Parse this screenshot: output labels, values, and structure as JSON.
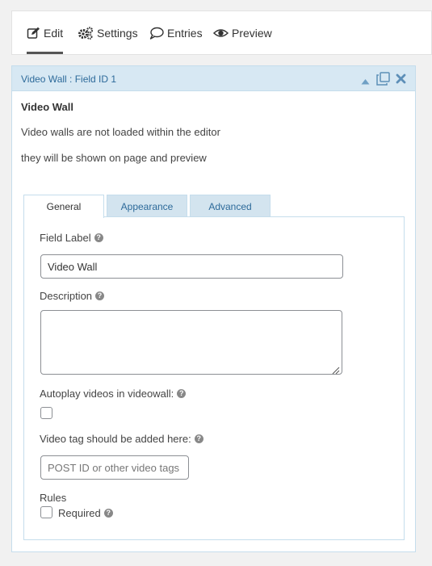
{
  "nav": {
    "tabs": [
      {
        "label": "Edit",
        "icon": "edit-icon",
        "active": true
      },
      {
        "label": "Settings",
        "icon": "gears-icon",
        "active": false
      },
      {
        "label": "Entries",
        "icon": "comment-icon",
        "active": false
      },
      {
        "label": "Preview",
        "icon": "eye-icon",
        "active": false
      }
    ]
  },
  "field": {
    "header_title": "Video Wall : Field ID 1",
    "name": "Video Wall",
    "notice_line1": "Video walls are not loaded within the editor",
    "notice_line2": "they will be shown on page and preview"
  },
  "settings_tabs": [
    {
      "label": "General",
      "active": true
    },
    {
      "label": "Appearance",
      "active": false
    },
    {
      "label": "Advanced",
      "active": false
    }
  ],
  "form": {
    "field_label": {
      "label": "Field Label",
      "value": "Video Wall"
    },
    "description": {
      "label": "Description",
      "value": ""
    },
    "autoplay": {
      "label": "Autoplay videos in videowall:",
      "checked": false
    },
    "video_tag": {
      "label": "Video tag should be added here:",
      "placeholder": "POST ID or other video tags",
      "value": ""
    },
    "rules": {
      "label": "Rules",
      "required_label": "Required",
      "required_checked": false
    }
  },
  "colors": {
    "header_bg": "#d7e8f3",
    "link_blue": "#2d6a9a",
    "border_blue": "#c5ddec"
  }
}
